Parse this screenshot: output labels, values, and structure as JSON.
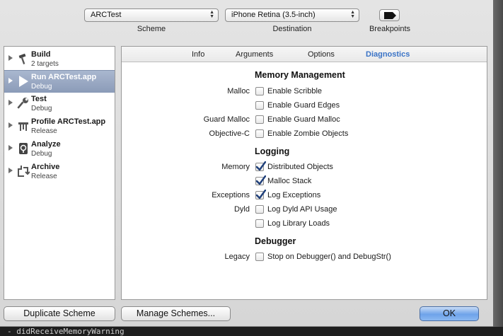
{
  "toolbar": {
    "scheme_value": "ARCTest",
    "scheme_label": "Scheme",
    "destination_value": "iPhone Retina (3.5-inch)",
    "destination_label": "Destination",
    "breakpoints_label": "Breakpoints"
  },
  "actions": [
    {
      "name": "Build",
      "sub": "2 targets",
      "icon": "hammer-icon"
    },
    {
      "name": "Run ARCTest.app",
      "sub": "Debug",
      "icon": "play-icon",
      "selected": true
    },
    {
      "name": "Test",
      "sub": "Debug",
      "icon": "wrench-icon"
    },
    {
      "name": "Profile ARCTest.app",
      "sub": "Release",
      "icon": "instruments-icon"
    },
    {
      "name": "Analyze",
      "sub": "Debug",
      "icon": "analyze-icon"
    },
    {
      "name": "Archive",
      "sub": "Release",
      "icon": "archive-icon"
    }
  ],
  "tabs": [
    {
      "label": "Info"
    },
    {
      "label": "Arguments"
    },
    {
      "label": "Options"
    },
    {
      "label": "Diagnostics",
      "active": true
    }
  ],
  "diagnostics": {
    "memory_management": {
      "title": "Memory Management",
      "malloc_label": "Malloc",
      "enable_scribble": {
        "label": "Enable Scribble",
        "checked": false
      },
      "enable_guard_edges": {
        "label": "Enable Guard Edges",
        "checked": false
      },
      "guard_malloc_label": "Guard Malloc",
      "enable_guard_malloc": {
        "label": "Enable Guard Malloc",
        "checked": false
      },
      "objc_label": "Objective-C",
      "enable_zombie": {
        "label": "Enable Zombie Objects",
        "checked": false
      }
    },
    "logging": {
      "title": "Logging",
      "memory_label": "Memory",
      "distributed_objects": {
        "label": "Distributed Objects",
        "checked": true
      },
      "malloc_stack": {
        "label": "Malloc Stack",
        "checked": true
      },
      "exceptions_label": "Exceptions",
      "log_exceptions": {
        "label": "Log Exceptions",
        "checked": true
      },
      "dyld_label": "Dyld",
      "log_dyld_api": {
        "label": "Log Dyld API Usage",
        "checked": false
      },
      "log_library_loads": {
        "label": "Log Library Loads",
        "checked": false
      }
    },
    "debugger": {
      "title": "Debugger",
      "legacy_label": "Legacy",
      "stop_on_debugger": {
        "label": "Stop on Debugger() and DebugStr()",
        "checked": false
      }
    }
  },
  "buttons": {
    "duplicate": "Duplicate Scheme",
    "manage": "Manage Schemes...",
    "ok": "OK"
  },
  "background": {
    "editor_line": "- didReceiveMemoryWarning"
  },
  "colors": {
    "accent": "#3a73c6",
    "selection": "#8b9bb8",
    "ok_button": "#6ea3ea"
  }
}
